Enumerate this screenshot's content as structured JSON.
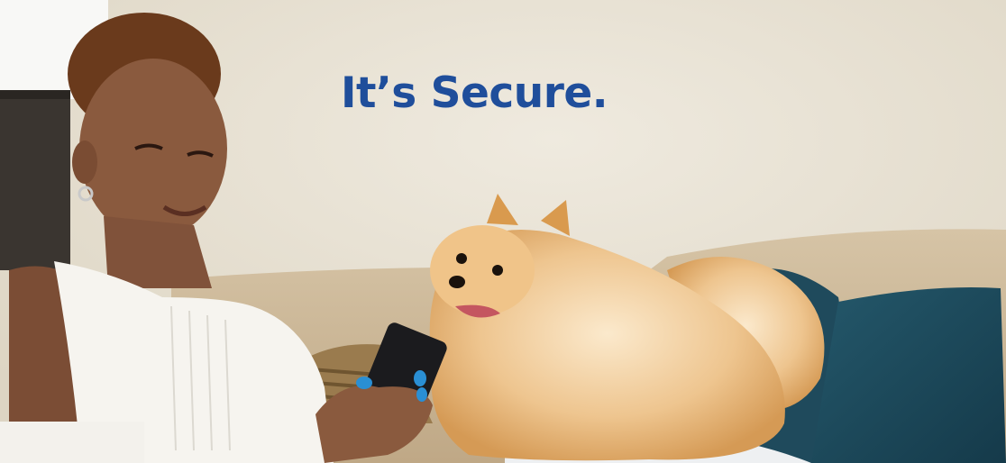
{
  "banner": {
    "headline": "It’s Secure."
  },
  "colors": {
    "headline": "#1f4e9b",
    "wall": "#e8e2d4",
    "sofa": "#cdb99b",
    "pillow": "#1c4a5b",
    "dog_fur": "#e3b06e",
    "shirt": "#f6f4ef",
    "skin": "#8a5a3e",
    "hair": "#6a3a1c",
    "nails": "#2a8fd4"
  }
}
